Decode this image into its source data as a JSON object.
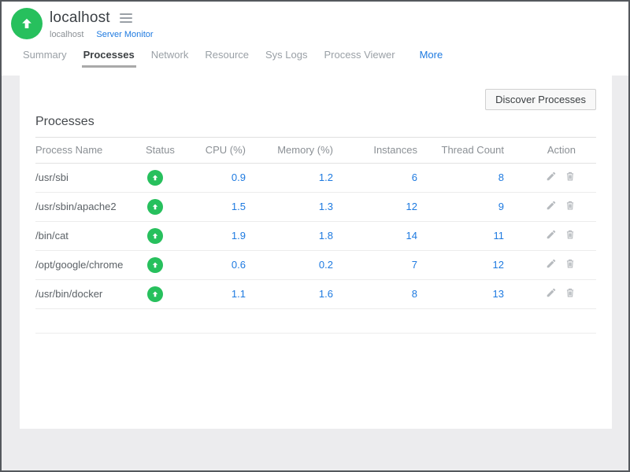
{
  "header": {
    "title": "localhost",
    "breadcrumb_host": "localhost",
    "monitor_type_link": "Server Monitor",
    "avatar_icon": "up-arrow-icon",
    "menu_icon": "hamburger-icon"
  },
  "tabs": [
    {
      "label": "Summary",
      "active": false,
      "accent": false
    },
    {
      "label": "Processes",
      "active": true,
      "accent": false
    },
    {
      "label": "Network",
      "active": false,
      "accent": false
    },
    {
      "label": "Resource",
      "active": false,
      "accent": false
    },
    {
      "label": "Sys Logs",
      "active": false,
      "accent": false
    },
    {
      "label": "Process Viewer",
      "active": false,
      "accent": false
    },
    {
      "label": "More",
      "active": false,
      "accent": true
    }
  ],
  "main": {
    "discover_button": "Discover Processes",
    "section_title": "Processes",
    "table": {
      "columns": [
        "Process Name",
        "Status",
        "CPU (%)",
        "Memory (%)",
        "Instances",
        "Thread Count",
        "Action"
      ],
      "rows": [
        {
          "name": "/usr/sbi",
          "status": "up",
          "cpu": "0.9",
          "memory": "1.2",
          "instances": "6",
          "threads": "8"
        },
        {
          "name": "/usr/sbin/apache2",
          "status": "up",
          "cpu": "1.5",
          "memory": "1.3",
          "instances": "12",
          "threads": "9"
        },
        {
          "name": "/bin/cat",
          "status": "up",
          "cpu": "1.9",
          "memory": "1.8",
          "instances": "14",
          "threads": "11"
        },
        {
          "name": "/opt/google/chrome",
          "status": "up",
          "cpu": "0.6",
          "memory": "0.2",
          "instances": "7",
          "threads": "12"
        },
        {
          "name": "/usr/bin/docker",
          "status": "up",
          "cpu": "1.1",
          "memory": "1.6",
          "instances": "8",
          "threads": "13"
        }
      ],
      "row_action_icons": [
        "edit-pencil-icon",
        "delete-trash-icon"
      ],
      "status_icon": "up-arrow-badge-icon",
      "trailing_empty_row": true
    }
  },
  "colors": {
    "accent_blue": "#1e7ae0",
    "status_green": "#27c05d",
    "background_gray": "#ececee",
    "inactive_tab_gray": "#9aa0a6"
  }
}
